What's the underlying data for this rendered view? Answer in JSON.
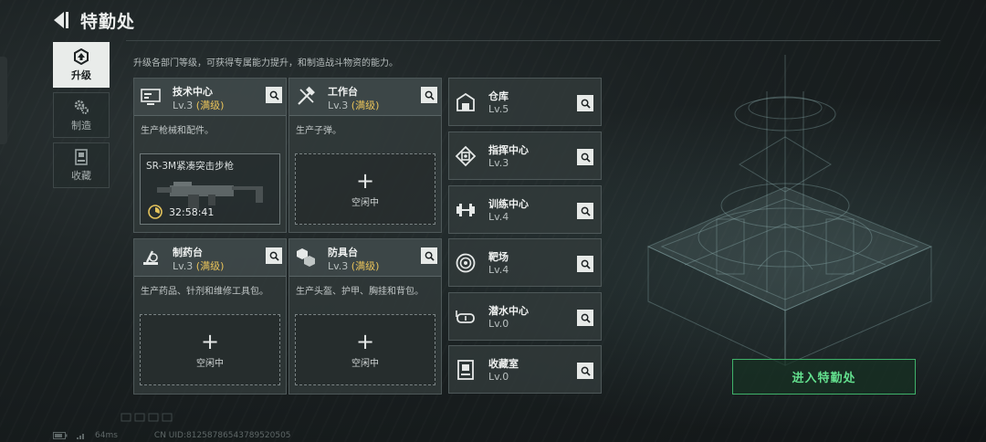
{
  "header": {
    "title": "特勤处",
    "back_icon": "back-arrow-icon"
  },
  "nav": {
    "tabs": [
      {
        "label": "升级",
        "icon": "upgrade-icon",
        "active": true
      },
      {
        "label": "制造",
        "icon": "gear-icon",
        "active": false
      },
      {
        "label": "收藏",
        "icon": "collection-icon",
        "active": false
      }
    ]
  },
  "description": "升级各部门等级，可获得专属能力提升，和制造战斗物资的能力。",
  "cards": [
    {
      "name": "技术中心",
      "level": "Lv.3",
      "level_tag": "(满级)",
      "icon": "tech-center-icon",
      "desc": "生产枪械和配件。",
      "slot": {
        "item_name": "SR-3M紧凑突击步枪",
        "timer": "32:58:41",
        "timer_icon": "timer-icon",
        "image": "rifle-icon"
      }
    },
    {
      "name": "工作台",
      "level": "Lv.3",
      "level_tag": "(满级)",
      "icon": "workbench-icon",
      "desc": "生产子弹。",
      "slot": {
        "plus": "+",
        "label": "空闲中"
      }
    },
    {
      "name": "制药台",
      "level": "Lv.3",
      "level_tag": "(满级)",
      "icon": "pharmacy-icon",
      "desc": "生产药品、针剂和维修工具包。",
      "slot": {
        "plus": "+",
        "label": "空闲中"
      }
    },
    {
      "name": "防具台",
      "level": "Lv.3",
      "level_tag": "(满级)",
      "icon": "armor-bench-icon",
      "desc": "生产头盔、护甲、胸挂和背包。",
      "slot": {
        "plus": "+",
        "label": "空闲中"
      }
    }
  ],
  "buildings": [
    {
      "name": "仓库",
      "level": "Lv.5",
      "icon": "warehouse-icon"
    },
    {
      "name": "指挥中心",
      "level": "Lv.3",
      "icon": "command-center-icon"
    },
    {
      "name": "训练中心",
      "level": "Lv.4",
      "icon": "dumbbell-icon"
    },
    {
      "name": "靶场",
      "level": "Lv.4",
      "icon": "target-icon"
    },
    {
      "name": "潜水中心",
      "level": "Lv.0",
      "icon": "diving-mask-icon"
    },
    {
      "name": "收藏室",
      "level": "Lv.0",
      "icon": "collection-room-icon"
    }
  ],
  "enter_button": "进入特勤处",
  "footer": {
    "ping": "64ms",
    "uid": "CN UID:8125878654378952050​5"
  },
  "colors": {
    "accent_green": "#3fb26a",
    "max_level_gold": "#e9c35a",
    "active_tab": "#e9ecea"
  }
}
